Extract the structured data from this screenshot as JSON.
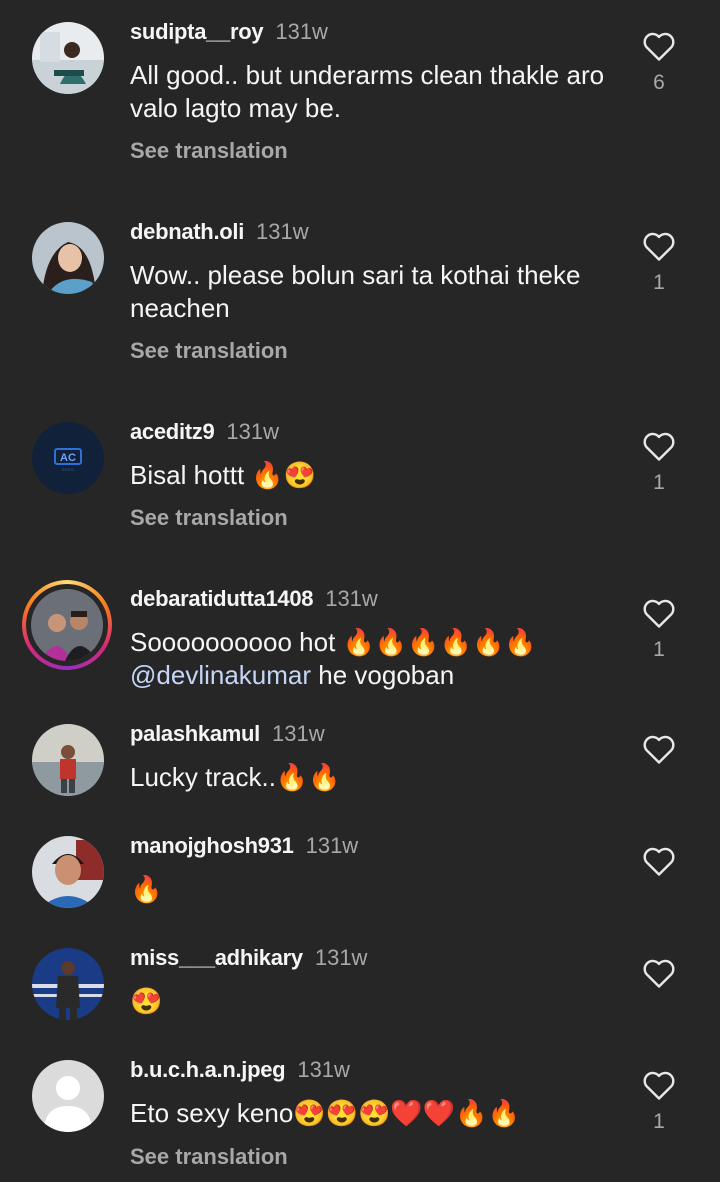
{
  "comments": [
    {
      "username": "sudipta__roy",
      "time": "131w",
      "text": "All good.. but underarms clean thakle aro valo lagto may be.",
      "see_translation": "See translation",
      "likes": "6",
      "avatar": "woman-portrait-avatar"
    },
    {
      "username": "debnath.oli",
      "time": "131w",
      "text": "Wow.. please bolun sari ta kothai theke neachen",
      "see_translation": "See translation",
      "likes": "1",
      "avatar": "woman-selfie-avatar"
    },
    {
      "username": "aceditz9",
      "time": "131w",
      "text": "Bisal hottt 🔥😍",
      "see_translation": "See translation",
      "likes": "1",
      "avatar": "ac-edits-logo-avatar"
    },
    {
      "username": "debaratidutta1408",
      "time": "131w",
      "text": "Soooooooooo hot 🔥🔥🔥🔥🔥🔥",
      "mention": "@devlinakumar",
      "text_after_mention": " he vogoban",
      "likes": "1",
      "avatar": "couple-photo-avatar"
    },
    {
      "username": "palashkamul",
      "time": "131w",
      "text": "Lucky track..🔥🔥",
      "avatar": "man-outdoor-avatar"
    },
    {
      "username": "manojghosh931",
      "time": "131w",
      "text": "🔥",
      "avatar": "man-portrait-avatar"
    },
    {
      "username": "miss___adhikary",
      "time": "131w",
      "text": "😍",
      "avatar": "woman-standing-avatar"
    },
    {
      "username": "b.u.c.h.a.n.jpeg",
      "time": "131w",
      "text": "Eto sexy keno😍😍😍❤️❤️🔥🔥",
      "see_translation": "See translation",
      "likes": "1",
      "avatar": "default-user-avatar"
    }
  ],
  "colors": {
    "background": "#262626",
    "text": "#f5f5f5",
    "secondary": "#a8a8a8",
    "mention": "#c5d5f5"
  },
  "icons": {
    "like": "heart-outline-icon"
  }
}
